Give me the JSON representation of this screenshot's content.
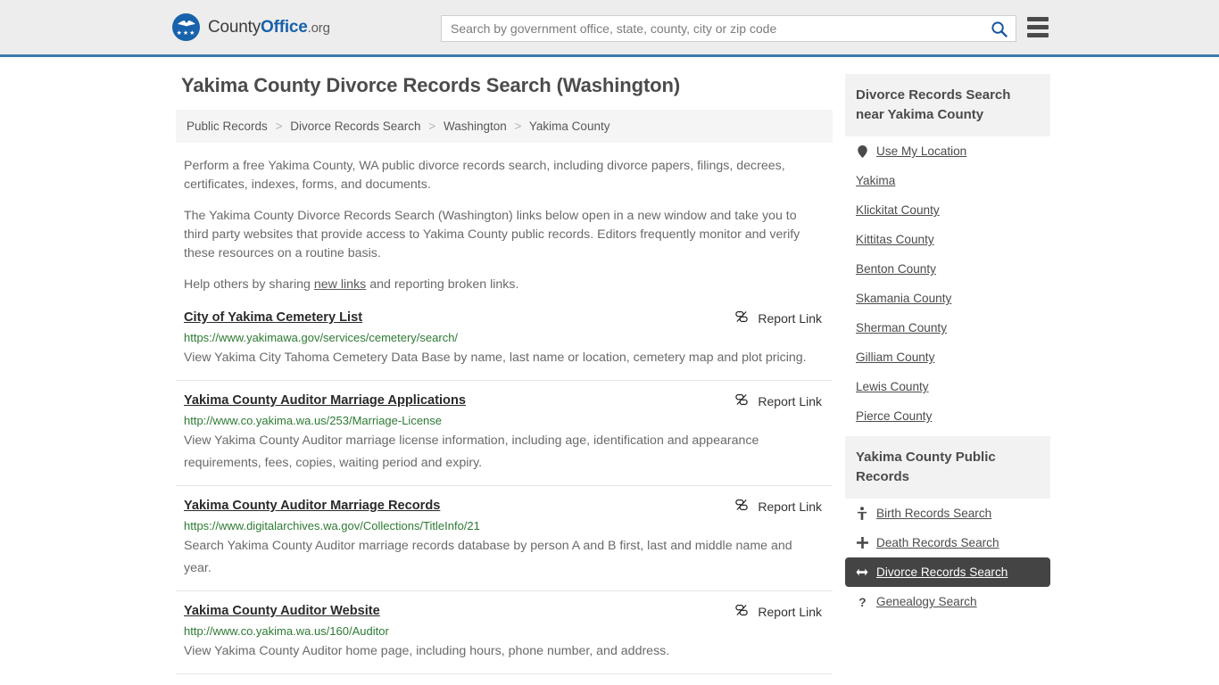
{
  "header": {
    "brand": {
      "part1": "County",
      "part2": "Office",
      "part3": ".org",
      "logo_icon": "eagle-shield-icon"
    },
    "search": {
      "placeholder": "Search by government office, state, county, city or zip code",
      "value": "",
      "icon": "search-icon"
    },
    "menu_icon": "hamburger-menu-icon",
    "accent_color": "#3b7ca8"
  },
  "main": {
    "title": "Yakima County Divorce Records Search (Washington)",
    "breadcrumb": [
      {
        "label": "Public Records",
        "current": false
      },
      {
        "label": "Divorce Records Search",
        "current": false
      },
      {
        "label": "Washington",
        "current": false
      },
      {
        "label": "Yakima County",
        "current": true
      }
    ],
    "breadcrumb_separator": ">",
    "intro": {
      "p1": "Perform a free Yakima County, WA public divorce records search, including divorce papers, filings, decrees, certificates, indexes, forms, and documents.",
      "p2": "The Yakima County Divorce Records Search (Washington) links below open in a new window and take you to third party websites that provide access to Yakima County public records. Editors frequently monitor and verify these resources on a routine basis.",
      "p3_before": "Help others by sharing ",
      "p3_link": "new links",
      "p3_after": " and reporting broken links."
    },
    "report_link_label": "Report Link",
    "report_link_icon": "broken-link-icon",
    "results": [
      {
        "title": "City of Yakima Cemetery List",
        "url": "https://www.yakimawa.gov/services/cemetery/search/",
        "description": "View Yakima City Tahoma Cemetery Data Base by name, last name or location, cemetery map and plot pricing."
      },
      {
        "title": "Yakima County Auditor Marriage Applications",
        "url": "http://www.co.yakima.wa.us/253/Marriage-License",
        "description": "View Yakima County Auditor marriage license information, including age, identification and appearance requirements, fees, copies, waiting period and expiry."
      },
      {
        "title": "Yakima County Auditor Marriage Records",
        "url": "https://www.digitalarchives.wa.gov/Collections/TitleInfo/21",
        "description": "Search Yakima County Auditor marriage records database by person A and B first, last and middle name and year."
      },
      {
        "title": "Yakima County Auditor Website",
        "url": "http://www.co.yakima.wa.us/160/Auditor",
        "description": "View Yakima County Auditor home page, including hours, phone number, and address."
      }
    ]
  },
  "sidebar": {
    "nearby": {
      "heading": "Divorce Records Search near Yakima County",
      "use_my_location": {
        "label": "Use My Location",
        "icon": "map-pin-icon"
      },
      "places": [
        "Yakima",
        "Klickitat County",
        "Kittitas County",
        "Benton County",
        "Skamania County",
        "Sherman County",
        "Gilliam County",
        "Lewis County",
        "Pierce County"
      ]
    },
    "public_records": {
      "heading": "Yakima County Public Records",
      "items": [
        {
          "label": "Birth Records Search",
          "icon": "baby-icon",
          "active": false
        },
        {
          "label": "Death Records Search",
          "icon": "cross-icon",
          "active": false
        },
        {
          "label": "Divorce Records Search",
          "icon": "arrows-split-icon",
          "active": true
        },
        {
          "label": "Genealogy Search",
          "icon": "question-mark-icon",
          "active": false
        }
      ],
      "active_background": "#444444"
    }
  }
}
